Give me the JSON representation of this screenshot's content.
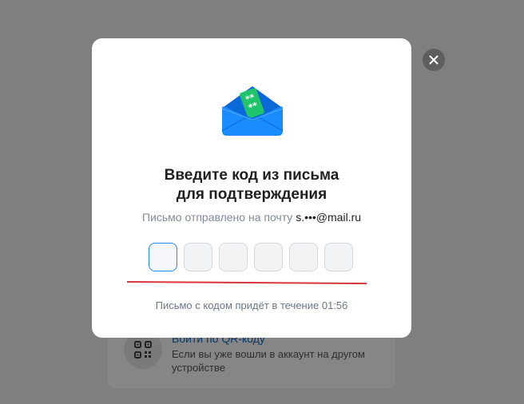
{
  "background": {
    "qr_login": {
      "title": "Войти по QR-коду",
      "subtitle": "Если вы уже вошли в аккаунт на другом устройстве"
    }
  },
  "modal": {
    "title_line1": "Введите код из письма",
    "title_line2": "для подтверждения",
    "subtitle_prefix": "Письмо отправлено на почту ",
    "email": "s.•••@mail.ru",
    "code_cells": [
      "",
      "",
      "",
      "",
      "",
      ""
    ],
    "timer_text": "Письмо с кодом придёт в течение 01:56",
    "icons": {
      "close": "close-icon",
      "envelope": "envelope-icon",
      "qr": "qr-code-icon"
    },
    "colors": {
      "accent": "#2688eb",
      "annotation_red": "#d9363e",
      "envelope_blue": "#1a8cff",
      "envelope_green": "#1fc36a"
    }
  }
}
